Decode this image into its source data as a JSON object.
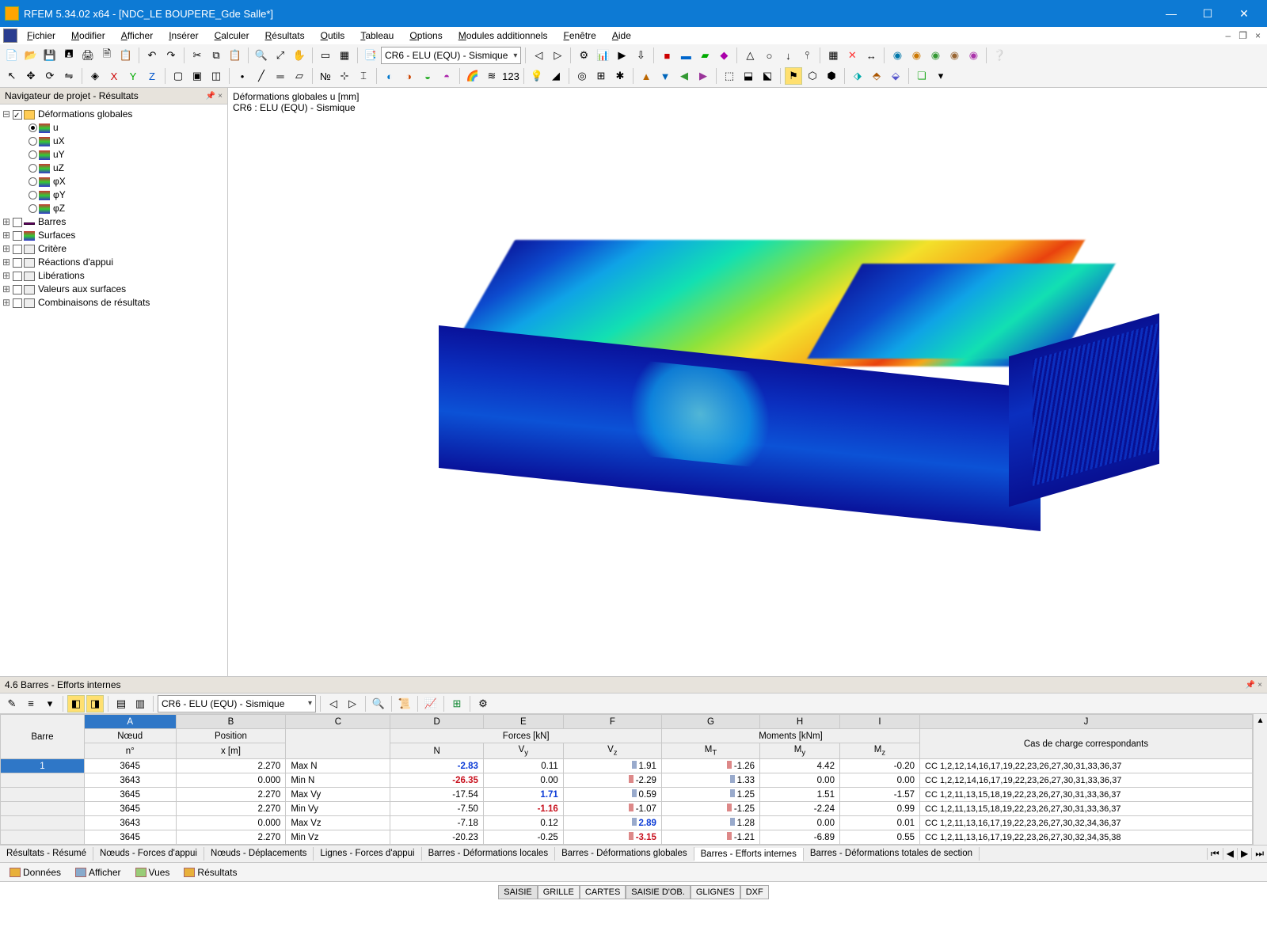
{
  "titlebar": {
    "app": "RFEM 5.34.02 x64 - [NDC_LE BOUPERE_Gde Salle*]"
  },
  "menu": [
    "Fichier",
    "Modifier",
    "Afficher",
    "Insérer",
    "Calculer",
    "Résultats",
    "Outils",
    "Tableau",
    "Options",
    "Modules additionnels",
    "Fenêtre",
    "Aide"
  ],
  "toolbar_combo_top": "CR6 - ELU (EQU) - Sismique",
  "nav": {
    "title": "Navigateur de projet - Résultats",
    "root": "Déformations globales",
    "radios": [
      "u",
      "uX",
      "uY",
      "uZ",
      "φX",
      "φY",
      "φZ"
    ],
    "items": [
      "Barres",
      "Surfaces",
      "Critère",
      "Réactions d'appui",
      "Libérations",
      "Valeurs aux surfaces",
      "Combinaisons de résultats"
    ]
  },
  "viewport": {
    "line1": "Déformations globales u [mm]",
    "line2": "CR6 : ELU (EQU) - Sismique"
  },
  "results": {
    "title": "4.6 Barres - Efforts internes",
    "combo": "CR6 - ELU (EQU) - Sismique",
    "col_letters": [
      "A",
      "B",
      "C",
      "D",
      "E",
      "F",
      "G",
      "H",
      "I",
      "J"
    ],
    "group1": {
      "barre": "Barre",
      "noeud": "Nœud",
      "pos": "Position",
      "forces": "Forces [kN]",
      "moments": "Moments [kNm]",
      "corr": "Cas de charge correspondants"
    },
    "group2": {
      "n": "n°",
      "n2": "n°",
      "x": "x [m]",
      "blank": "",
      "N": "N",
      "Vy": "Vy",
      "Vz": "Vz",
      "MT": "MT",
      "My": "My",
      "Mz": "Mz"
    },
    "rows": [
      {
        "barre": "1",
        "noeud": "3645",
        "x": "2.270",
        "type": "Max N",
        "N": "-2.83",
        "Nstyle": "bold blue",
        "Vy": "0.11",
        "Vz": "1.91",
        "MT": "-1.26",
        "My": "4.42",
        "Mz": "-0.20",
        "cc": "CC 1,2,12,14,16,17,19,22,23,26,27,30,31,33,36,37"
      },
      {
        "barre": "",
        "noeud": "3643",
        "x": "0.000",
        "type": "Min N",
        "N": "-26.35",
        "Nstyle": "bold red",
        "Vy": "0.00",
        "Vz": "-2.29",
        "MT": "1.33",
        "My": "0.00",
        "Mz": "0.00",
        "cc": "CC 1,2,12,14,16,17,19,22,23,26,27,30,31,33,36,37"
      },
      {
        "barre": "",
        "noeud": "3645",
        "x": "2.270",
        "type": "Max Vy",
        "N": "-17.54",
        "Vy": "1.71",
        "Vystyle": "bold blue",
        "Vz": "0.59",
        "MT": "1.25",
        "My": "1.51",
        "Mz": "-1.57",
        "cc": "CC 1,2,11,13,15,18,19,22,23,26,27,30,31,33,36,37"
      },
      {
        "barre": "",
        "noeud": "3645",
        "x": "2.270",
        "type": "Min Vy",
        "N": "-7.50",
        "Vy": "-1.16",
        "Vystyle": "bold red",
        "Vz": "-1.07",
        "MT": "-1.25",
        "My": "-2.24",
        "Mz": "0.99",
        "cc": "CC 1,2,11,13,15,18,19,22,23,26,27,30,31,33,36,37"
      },
      {
        "barre": "",
        "noeud": "3643",
        "x": "0.000",
        "type": "Max Vz",
        "N": "-7.18",
        "Vy": "0.12",
        "Vz": "2.89",
        "Vzstyle": "bold blue",
        "MT": "1.28",
        "My": "0.00",
        "Mz": "0.01",
        "cc": "CC 1,2,11,13,16,17,19,22,23,26,27,30,32,34,36,37"
      },
      {
        "barre": "",
        "noeud": "3645",
        "x": "2.270",
        "type": "Min Vz",
        "N": "-20.23",
        "Vy": "-0.25",
        "Vz": "-3.15",
        "Vzstyle": "bold red",
        "MT": "-1.21",
        "My": "-6.89",
        "Mz": "0.55",
        "cc": "CC 1,2,11,13,16,17,19,22,23,26,27,30,32,34,35,38"
      }
    ],
    "tabs": [
      "Résultats - Résumé",
      "Nœuds - Forces d'appui",
      "Nœuds - Déplacements",
      "Lignes - Forces d'appui",
      "Barres - Déformations locales",
      "Barres - Déformations globales",
      "Barres - Efforts internes",
      "Barres - Déformations totales de section"
    ],
    "active_tab": "Barres - Efforts internes"
  },
  "nav_tabs": [
    "Données",
    "Afficher",
    "Vues",
    "Résultats"
  ],
  "status": [
    "SAISIE",
    "GRILLE",
    "CARTES",
    "SAISIE D'OB.",
    "GLIGNES",
    "DXF"
  ]
}
